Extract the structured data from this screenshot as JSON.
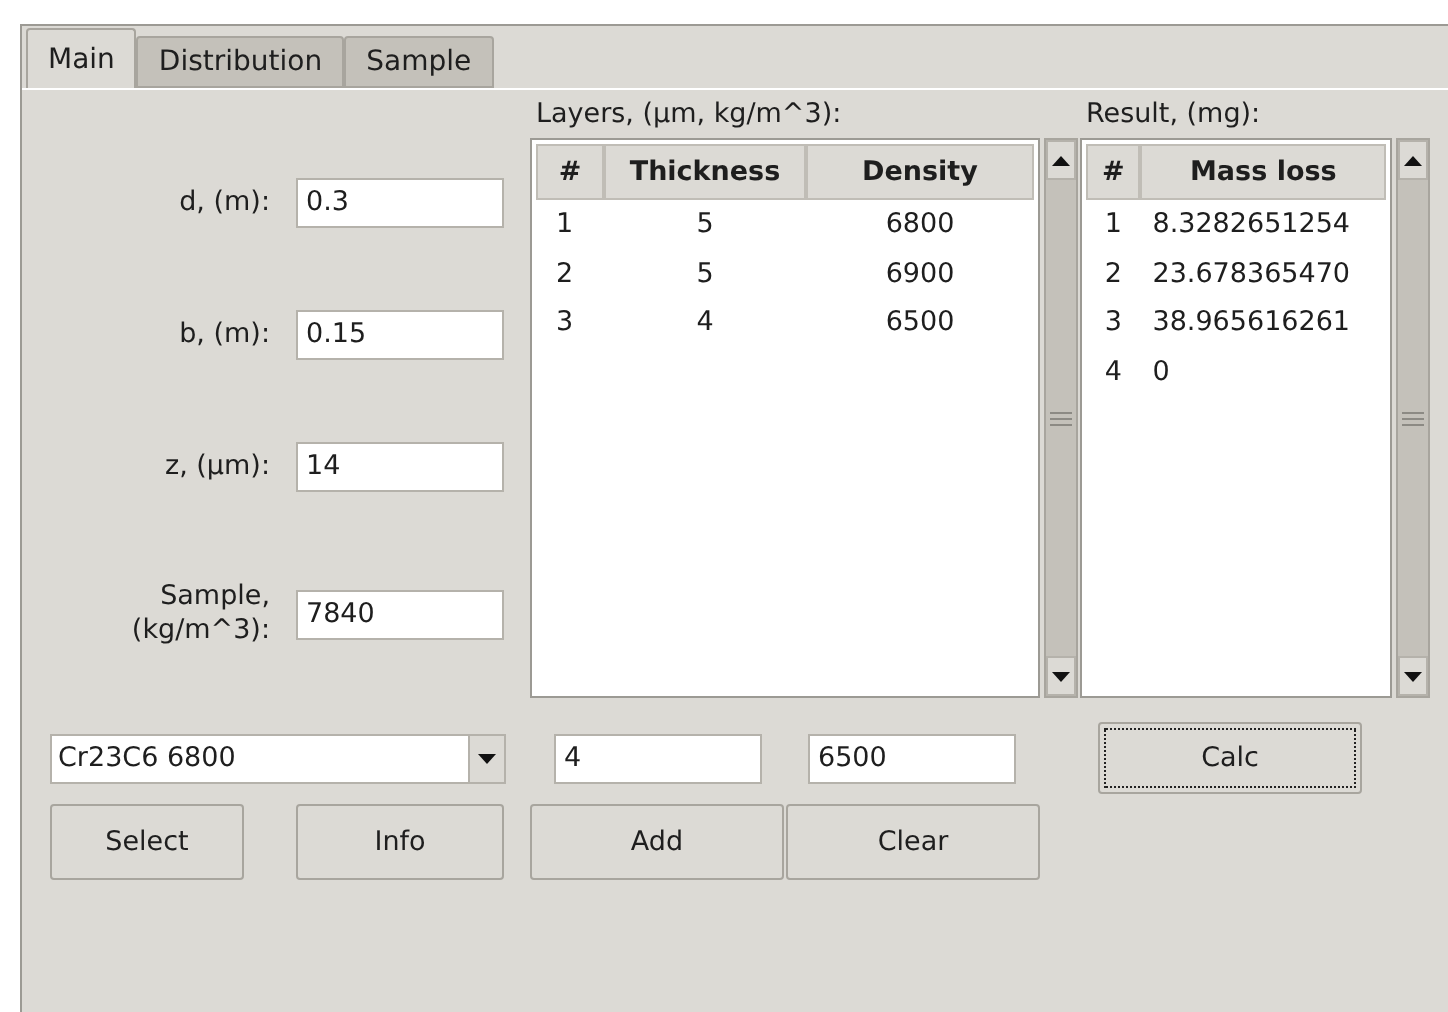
{
  "tabs": [
    {
      "label": "Main",
      "selected": true
    },
    {
      "label": "Distribution",
      "selected": false
    },
    {
      "label": "Sample",
      "selected": false
    }
  ],
  "fields": [
    {
      "label": "d, (m):",
      "value": "0.3"
    },
    {
      "label": "b, (m):",
      "value": "0.15"
    },
    {
      "label": "z, (µm):",
      "value": "14"
    },
    {
      "label": "Sample,\n(kg/m^3):",
      "value": "7840"
    }
  ],
  "layers": {
    "title": "Layers, (µm, kg/m^3):",
    "columns": [
      "#",
      "Thickness",
      "Density"
    ],
    "rows": [
      [
        "1",
        "5",
        "6800"
      ],
      [
        "2",
        "5",
        "6900"
      ],
      [
        "3",
        "4",
        "6500"
      ]
    ]
  },
  "result": {
    "title": "Result, (mg):",
    "columns": [
      "#",
      "Mass loss"
    ],
    "rows": [
      [
        "1",
        "8.3282651254"
      ],
      [
        "2",
        "23.678365470"
      ],
      [
        "3",
        "38.965616261"
      ],
      [
        "4",
        "0"
      ]
    ]
  },
  "material": {
    "value": "Cr23C6 6800"
  },
  "thickness": {
    "value": "4"
  },
  "density": {
    "value": "6500"
  },
  "calc": {
    "label": "Calc",
    "focused": true
  },
  "buttons": [
    "Select",
    "Info",
    "Add",
    "Clear"
  ]
}
